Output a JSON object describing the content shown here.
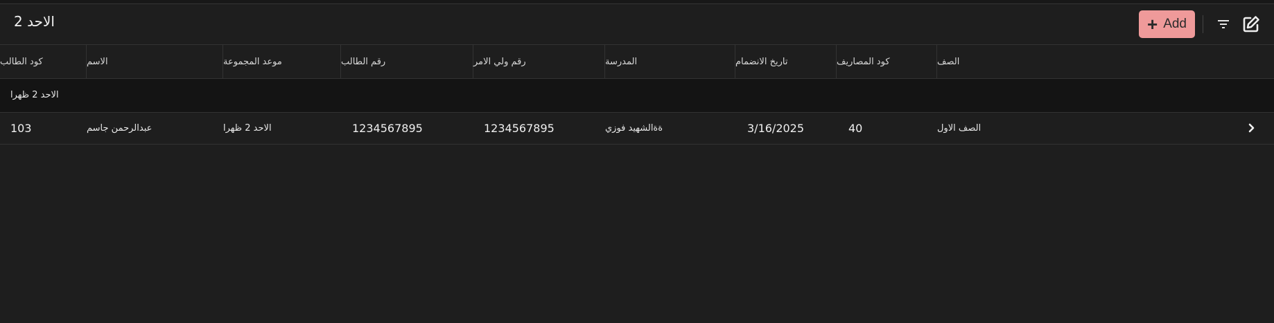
{
  "header": {
    "title": "الاحد 2",
    "add_label": "Add",
    "icons": [
      "plus-icon",
      "filter-icon",
      "edit-icon"
    ]
  },
  "table": {
    "columns": [
      {
        "key": "student_code",
        "label": "كود الطالب"
      },
      {
        "key": "name",
        "label": "الاسم"
      },
      {
        "key": "group_time",
        "label": "موعد المجموعة"
      },
      {
        "key": "student_phone",
        "label": "رقم الطالب"
      },
      {
        "key": "guardian_phone",
        "label": "رقم ولي الامر"
      },
      {
        "key": "school",
        "label": "المدرسة"
      },
      {
        "key": "join_date",
        "label": "تاريخ الانضمام"
      },
      {
        "key": "fees_code",
        "label": "كود المصاريف"
      },
      {
        "key": "grade",
        "label": "الصف"
      }
    ],
    "group_label": "الاحد 2 ظهرا",
    "rows": [
      {
        "student_code": "103",
        "name": "عبدالرحمن جاسم",
        "group_time": "الاحد 2 ظهرا",
        "student_phone": "1234567895",
        "guardian_phone": "1234567895",
        "school": "ةةالشهيد فوزي",
        "join_date": "3/16/2025",
        "fees_code": "40",
        "grade": "الصف الاول"
      }
    ]
  },
  "colors": {
    "background": "#1e1e1e",
    "group_row": "#141414",
    "accent": "#ef9a9a",
    "border": "#333333"
  }
}
